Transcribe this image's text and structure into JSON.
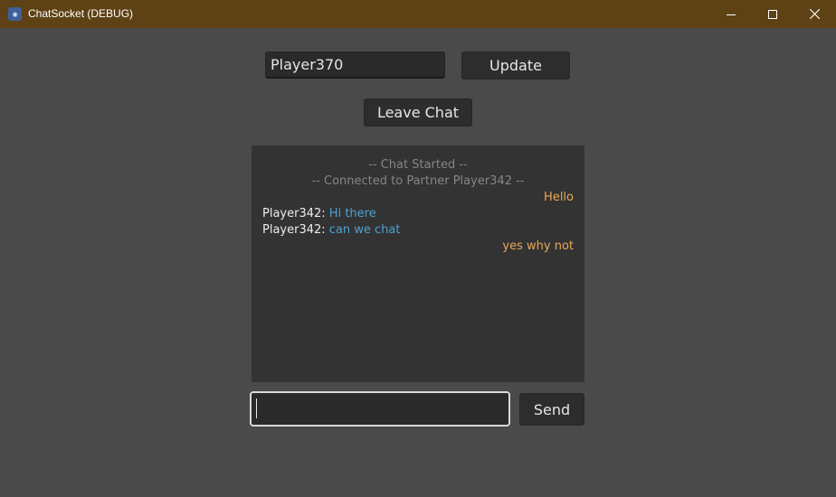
{
  "window": {
    "title": "ChatSocket (DEBUG)",
    "icon": "godot-engine-icon",
    "controls": [
      "minimize",
      "maximize",
      "close"
    ]
  },
  "profile": {
    "name_value": "Player370",
    "update_label": "Update"
  },
  "chat": {
    "leave_label": "Leave Chat",
    "system_messages": [
      "-- Chat Started --",
      "-- Connected to Partner Player342 --"
    ],
    "messages": [
      {
        "from": "self",
        "text": "Hello"
      },
      {
        "from": "partner",
        "sender": "Player342:",
        "text": "Hi there"
      },
      {
        "from": "partner",
        "sender": "Player342:",
        "text": "can we chat"
      },
      {
        "from": "self",
        "text": "yes why not"
      }
    ]
  },
  "composer": {
    "value": "",
    "send_label": "Send"
  },
  "colors": {
    "titlebar": "#5e4215",
    "background": "#4a4a4a",
    "self_message": "#e9a859",
    "partner_message": "#4da0d2",
    "system_message": "#858585"
  }
}
